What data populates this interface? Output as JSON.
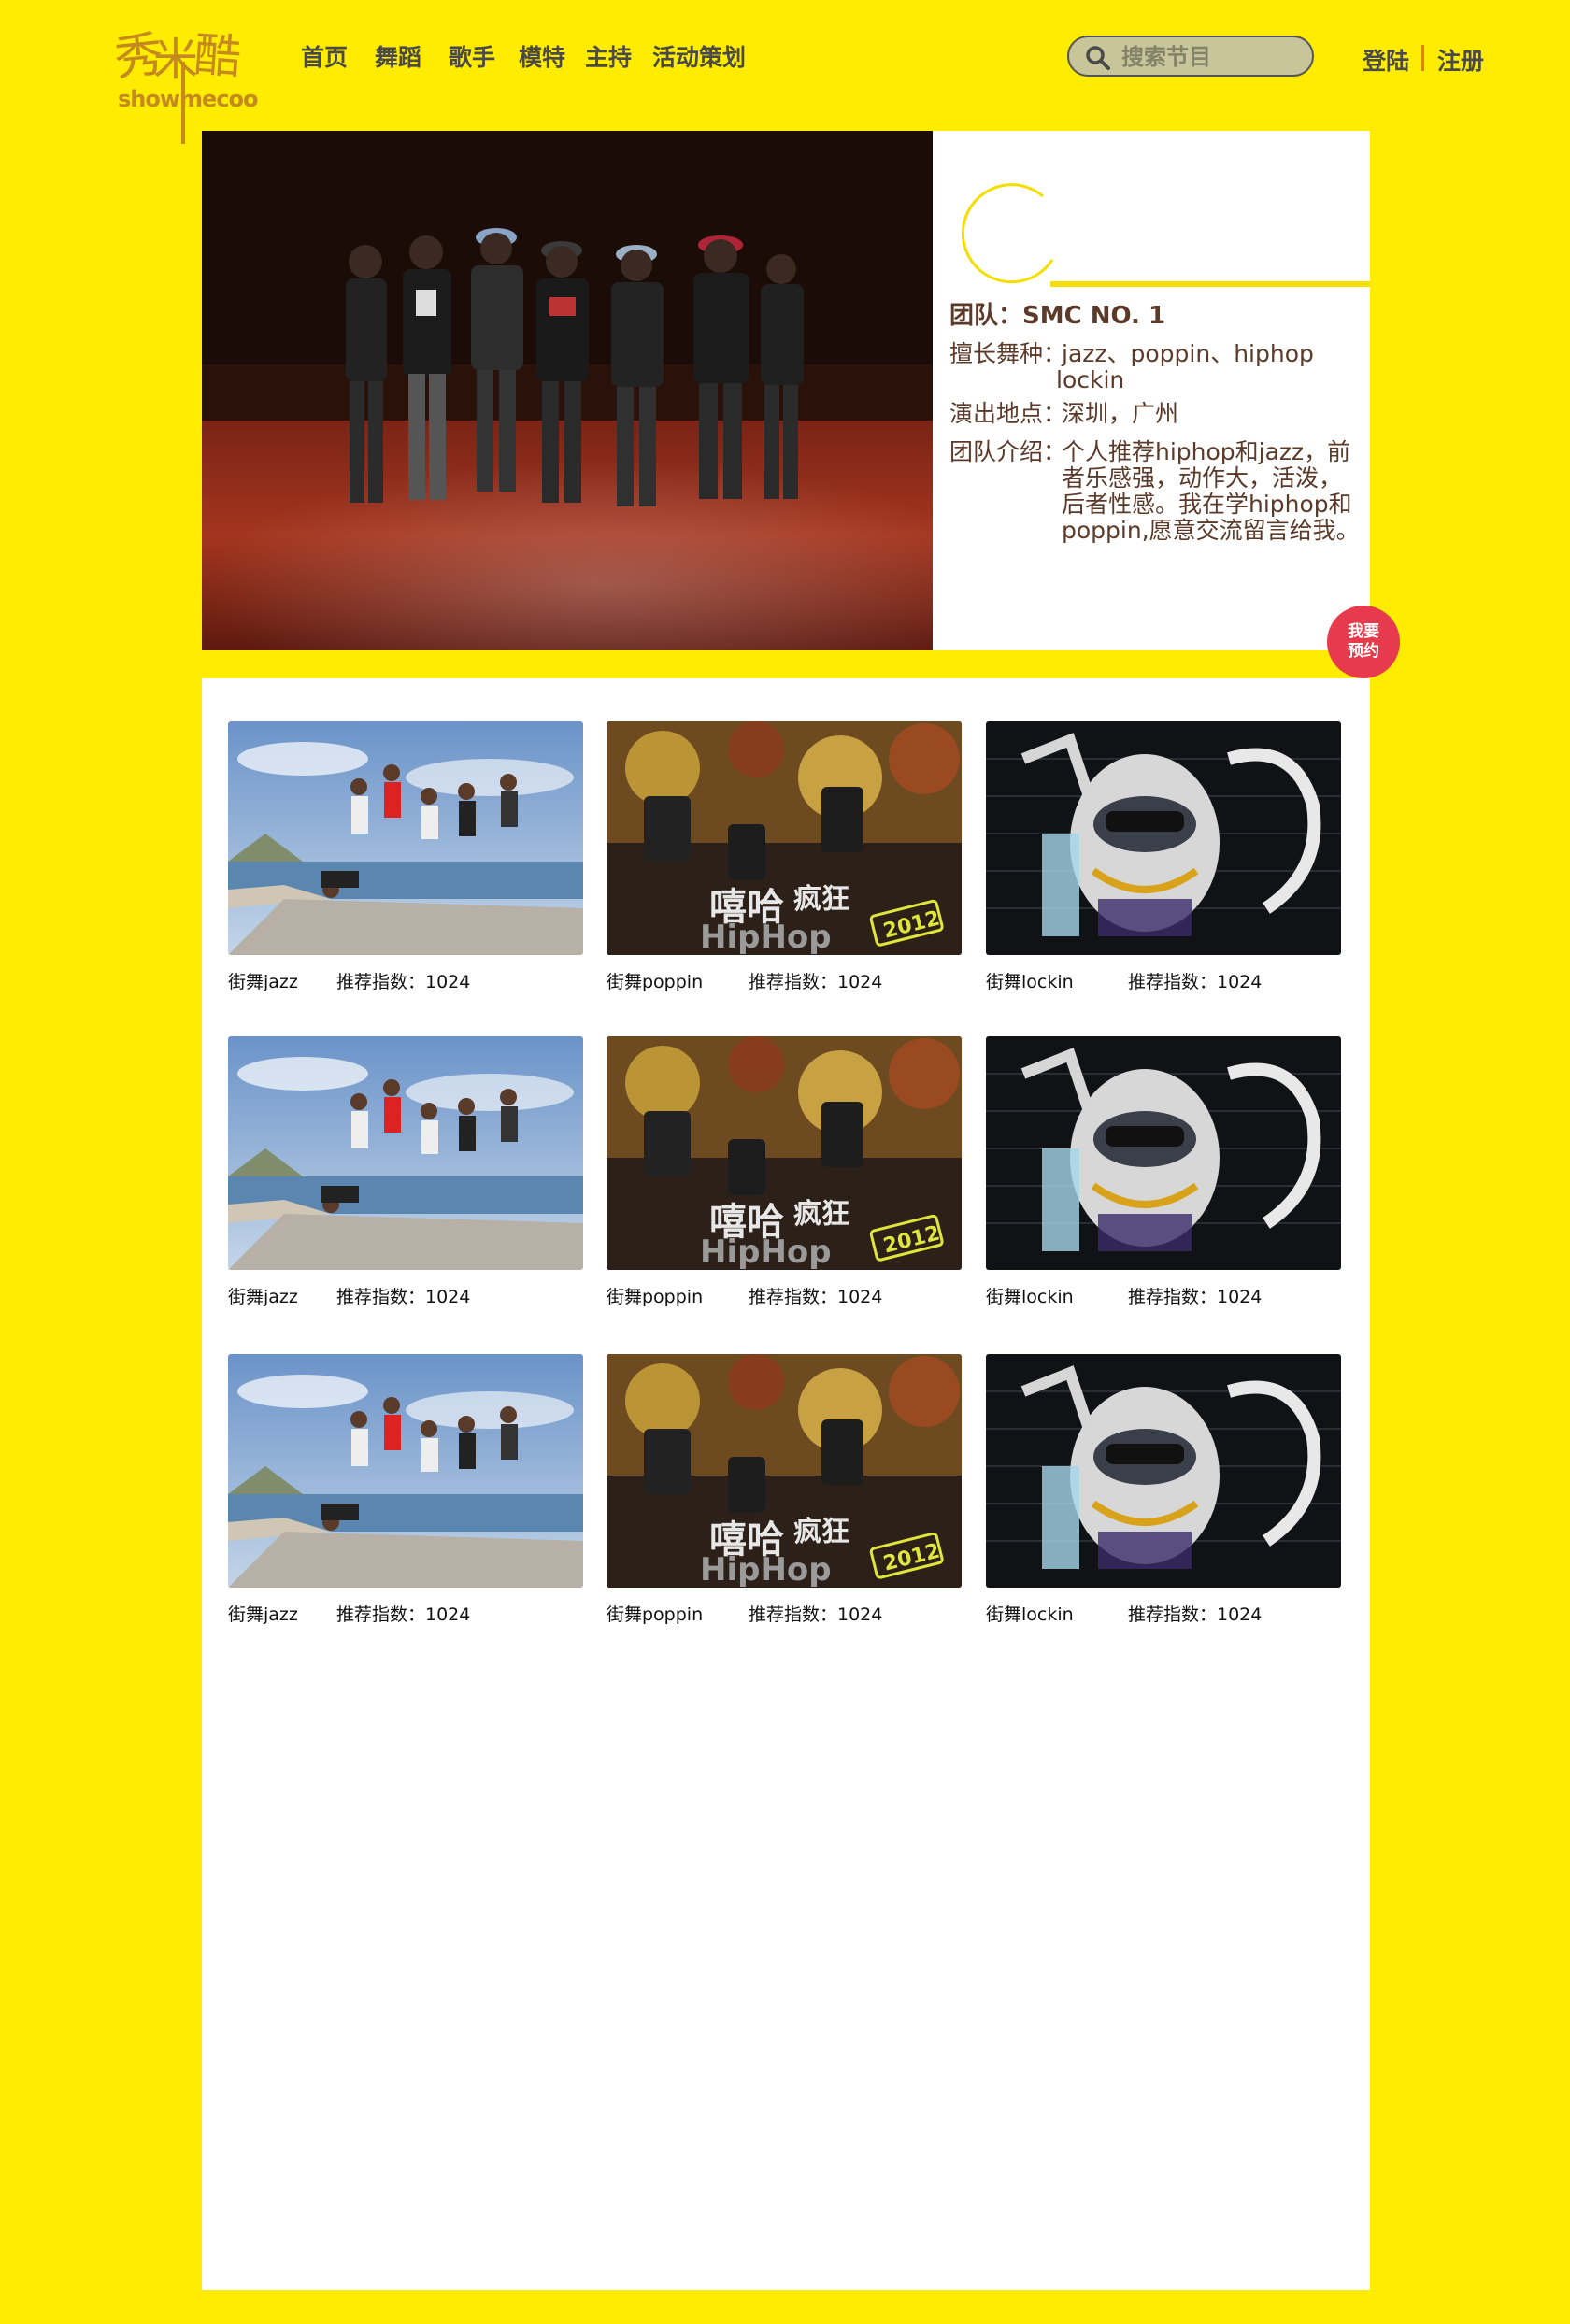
{
  "logo": {
    "chars": [
      "秀",
      "米",
      "酷"
    ],
    "subtext": "showmecoo"
  },
  "nav": {
    "items": [
      "首页",
      "舞蹈",
      "歌手",
      "模特",
      "主持",
      "活动策划"
    ]
  },
  "search": {
    "placeholder": "搜索节目"
  },
  "auth": {
    "login": "登陆",
    "register": "注册"
  },
  "hero": {
    "team_label": "团队：",
    "team_value": "SMC NO. 1",
    "dance_label": "擅长舞种：",
    "dance_value_line1": "jazz、poppin、hiphop",
    "dance_value_line2": "lockin",
    "location_label": "演出地点：",
    "location_value": "深圳，广州",
    "intro_label": "团队介绍：",
    "intro_lines": [
      "个人推荐hiphop和jazz，前",
      "者乐感强，动作大，活泼，",
      "后者性感。我在学hiphop和",
      "poppin,愿意交流留言给我。"
    ],
    "book_line1": "我要",
    "book_line2": "预约",
    "accent_color": "#f5df00"
  },
  "gallery": {
    "rows": [
      [
        {
          "name": "街舞jazz",
          "score": "推荐指数：1024",
          "image": "jazz-group-photo"
        },
        {
          "name": "街舞poppin",
          "score": "推荐指数：1024",
          "image": "hiphop-poster"
        },
        {
          "name": "街舞lockin",
          "score": "推荐指数：1024",
          "image": "graffiti-art"
        }
      ],
      [
        {
          "name": "街舞jazz",
          "score": "推荐指数：1024",
          "image": "jazz-group-photo"
        },
        {
          "name": "街舞poppin",
          "score": "推荐指数：1024",
          "image": "hiphop-poster"
        },
        {
          "name": "街舞lockin",
          "score": "推荐指数：1024",
          "image": "graffiti-art"
        }
      ],
      [
        {
          "name": "街舞jazz",
          "score": "推荐指数：1024",
          "image": "jazz-group-photo"
        },
        {
          "name": "街舞poppin",
          "score": "推荐指数：1024",
          "image": "hiphop-poster"
        },
        {
          "name": "街舞lockin",
          "score": "推荐指数：1024",
          "image": "graffiti-art"
        }
      ]
    ],
    "poster_texts": {
      "line1": "嘻哈",
      "line2": "疯狂",
      "line3": "HipHop",
      "badge": "2012"
    }
  },
  "colors": {
    "background": "#ffec00",
    "panel": "#ffffff",
    "text_brown": "#5b3a2a",
    "book_button": "#e73a4c"
  }
}
